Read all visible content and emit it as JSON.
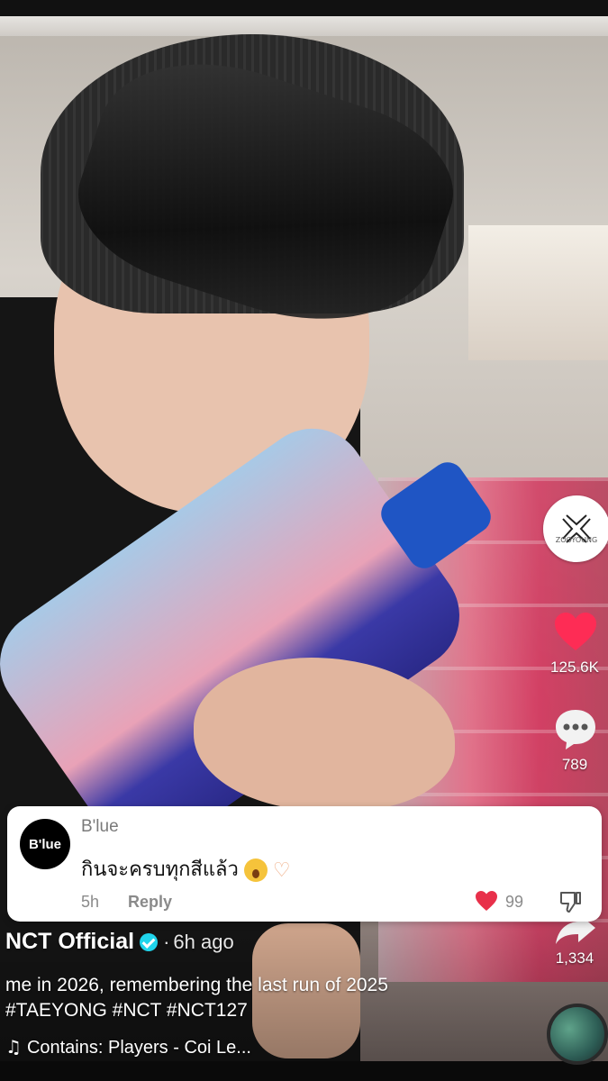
{
  "profile": {
    "logo_text": "ZOOYOUNG"
  },
  "rail": {
    "likes": "125.6K",
    "comments": "789",
    "shares": "1,334"
  },
  "comment": {
    "avatar_label": "B'lue",
    "username": "B'lue",
    "text": "กินจะครบทุกสีแล้ว",
    "time": "5h",
    "reply_label": "Reply",
    "likes": "99"
  },
  "post": {
    "author": "NCT Official",
    "separator": "·",
    "posted": "6h ago",
    "caption_line1": "me in 2026, remembering the last run of 2025",
    "caption_line2": "#TAEYONG #NCT #NCT127",
    "music": "Contains: Players - Coi Le..."
  },
  "colors": {
    "like": "#fe2c55",
    "verified": "#20d5ec",
    "comment_like": "#e8304a"
  },
  "icons": [
    "heart-icon",
    "comment-bubble-icon",
    "share-arrow-icon",
    "music-note-icon",
    "verified-badge-icon",
    "dislike-icon"
  ]
}
